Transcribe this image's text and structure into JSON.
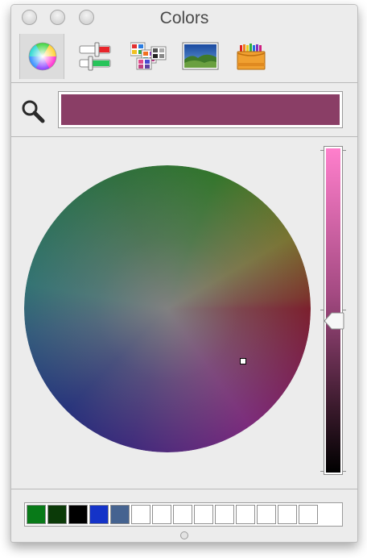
{
  "window": {
    "title": "Colors"
  },
  "toolbar": {
    "tools": [
      {
        "name": "color-wheel-tool",
        "icon": "color-wheel-icon",
        "selected": true
      },
      {
        "name": "color-sliders-tool",
        "icon": "sliders-icon",
        "selected": false
      },
      {
        "name": "color-palettes-tool",
        "icon": "palettes-icon",
        "selected": false
      },
      {
        "name": "image-palettes-tool",
        "icon": "image-icon",
        "selected": false
      },
      {
        "name": "crayons-tool",
        "icon": "crayons-icon",
        "selected": false
      }
    ]
  },
  "search": {
    "icon": "magnifier-icon"
  },
  "current_color": "#8a3e66",
  "brightness": {
    "top": "#ff7fcc",
    "bottom": "#000000",
    "value": 0.5
  },
  "favorites": [
    "#087a18",
    "#0b3a08",
    "#000000",
    "#1433c8",
    "#456390",
    "",
    "",
    "",
    "",
    "",
    "",
    "",
    "",
    ""
  ]
}
